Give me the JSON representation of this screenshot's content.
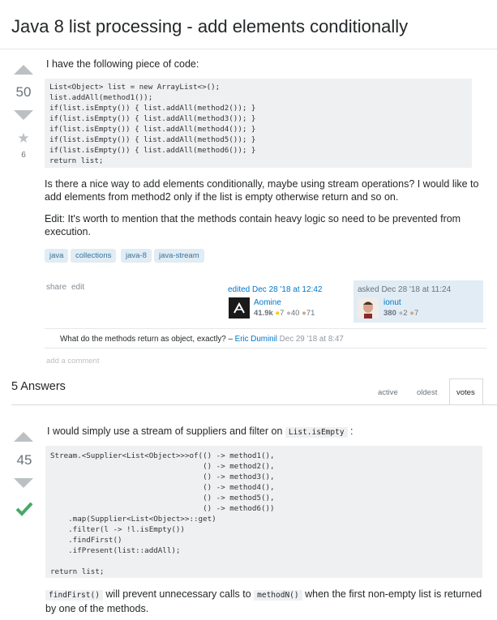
{
  "question": {
    "title": "Java 8 list processing - add elements conditionally",
    "votes": "50",
    "favorites": "6",
    "intro": "I have the following piece of code:",
    "code_lines": [
      "List<Object> list = new ArrayList<>();",
      "list.addAll(method1());",
      "if(list.isEmpty()) { list.addAll(method2()); }",
      "if(list.isEmpty()) { list.addAll(method3()); }",
      "if(list.isEmpty()) { list.addAll(method4()); }",
      "if(list.isEmpty()) { list.addAll(method5()); }",
      "if(list.isEmpty()) { list.addAll(method6()); }",
      "return list;"
    ],
    "para1": "Is there a nice way to add elements conditionally, maybe using stream operations? I would like to add elements from method2 only if the list is empty otherwise return and so on.",
    "para2": "Edit: It's worth to mention that the methods contain heavy logic so need to be prevented from execution.",
    "tags": [
      "java",
      "collections",
      "java-8",
      "java-stream"
    ],
    "share": "share",
    "edit": "edit",
    "edited": {
      "label": "edited Dec 28 '18 at 12:42",
      "user": "Aomine",
      "rep": "41.9k",
      "gold": "7",
      "silver": "40",
      "bronze": "71"
    },
    "asked": {
      "label": "asked Dec 28 '18 at 11:24",
      "user": "ionut",
      "rep": "380",
      "gold": null,
      "silver": "2",
      "bronze": "7"
    },
    "comment": {
      "text": "What do the methods return as object, exactly? –",
      "author": "Eric Duminil",
      "date": "Dec 29 '18 at 8:47"
    },
    "add_comment": "add a comment"
  },
  "answers_header": {
    "count_label": "5 Answers",
    "tabs": [
      "active",
      "oldest",
      "votes"
    ],
    "active_tab": "votes"
  },
  "answer": {
    "votes": "45",
    "accepted": true,
    "intro_before": "I would simply use a stream of suppliers and filter on",
    "intro_code": "List.isEmpty",
    "intro_after": ":",
    "code_lines": [
      "Stream.<Supplier<List<Object>>>of(() -> method1(),",
      "                                  () -> method2(),",
      "                                  () -> method3(),",
      "                                  () -> method4(),",
      "                                  () -> method5(),",
      "                                  () -> method6())",
      "    .map(Supplier<List<Object>>::get)",
      "    .filter(l -> !l.isEmpty())",
      "    .findFirst()",
      "    .ifPresent(list::addAll);",
      "",
      "return list;"
    ],
    "outro_code1": "findFirst()",
    "outro_mid": "will prevent unnecessary calls to",
    "outro_code2": "methodN()",
    "outro_after": "when the first non-empty list is returned by one of the methods."
  },
  "colors": {
    "link": "#0077cc",
    "tag_bg": "#e1ecf4",
    "tag_fg": "#39739d",
    "accepted": "#48a868",
    "gold": "#ffcc01",
    "silver": "#b4b8bc",
    "bronze": "#d1a684"
  }
}
